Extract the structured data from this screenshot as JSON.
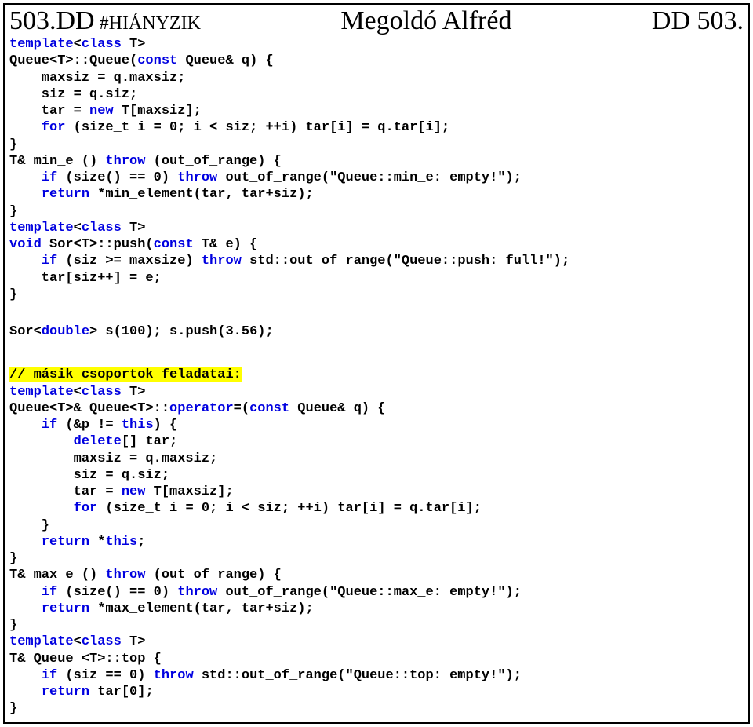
{
  "header": {
    "left_num": "503.DD",
    "left_tag": " #HIÁNYZIK",
    "center": "Megoldó Alfréd",
    "right": "DD 503."
  },
  "c": {
    "l01a": "template",
    "l01b": "<",
    "l01c": "class",
    "l01d": " T>",
    "l02a": "Queue<T>::Queue(",
    "l02b": "const",
    "l02c": " Queue& q) {",
    "l03": "    maxsiz = q.maxsiz;",
    "l04": "    siz = q.siz;",
    "l05a": "    tar = ",
    "l05b": "new",
    "l05c": " T[maxsiz];",
    "l06a": "    ",
    "l06b": "for",
    "l06c": " (size_t i = 0; i < siz; ++i) tar[i] = q.tar[i];",
    "l07": "}",
    "l08a": "T& min_e () ",
    "l08b": "throw",
    "l08c": " (out_of_range) {",
    "l09a": "    ",
    "l09b": "if",
    "l09c": " (size() == 0) ",
    "l09d": "throw",
    "l09e": " out_of_range(\"Queue::min_e: empty!\");",
    "l10a": "    ",
    "l10b": "return",
    "l10c": " *min_element(tar, tar+siz);",
    "l11": "}",
    "l12a": "template",
    "l12b": "<",
    "l12c": "class",
    "l12d": " T>",
    "l13a": "void",
    "l13b": " Sor<T>::push(",
    "l13c": "const",
    "l13d": " T& e) {",
    "l14a": "    ",
    "l14b": "if",
    "l14c": " (siz >= maxsize) ",
    "l14d": "throw",
    "l14e": " std::out_of_range(\"Queue::push: full!\");",
    "l15": "    tar[siz++] = e;",
    "l16": "}",
    "l17a": "Sor<",
    "l17b": "double",
    "l17c": "> s(100); s.push(3.56);",
    "l18": "// másik csoportok feladatai:",
    "l19a": "template",
    "l19b": "<",
    "l19c": "class",
    "l19d": " T>",
    "l20a": "Queue<T>& Queue<T>::",
    "l20b": "operator",
    "l20c": "=(",
    "l20d": "const",
    "l20e": " Queue& q) {",
    "l21a": "    ",
    "l21b": "if",
    "l21c": " (&p != ",
    "l21d": "this",
    "l21e": ") {",
    "l22a": "        ",
    "l22b": "delete",
    "l22c": "[] tar;",
    "l23": "        maxsiz = q.maxsiz;",
    "l24": "        siz = q.siz;",
    "l25a": "        tar = ",
    "l25b": "new",
    "l25c": " T[maxsiz];",
    "l26a": "        ",
    "l26b": "for",
    "l26c": " (size_t i = 0; i < siz; ++i) tar[i] = q.tar[i];",
    "l27": "    }",
    "l28a": "    ",
    "l28b": "return",
    "l28c": " *",
    "l28d": "this",
    "l28e": ";",
    "l29": "}",
    "l30a": "T& max_e () ",
    "l30b": "throw",
    "l30c": " (out_of_range) {",
    "l31a": "    ",
    "l31b": "if",
    "l31c": " (size() == 0) ",
    "l31d": "throw",
    "l31e": " out_of_range(\"Queue::max_e: empty!\");",
    "l32a": "    ",
    "l32b": "return",
    "l32c": " *max_element(tar, tar+siz);",
    "l33": "}",
    "l34a": "template",
    "l34b": "<",
    "l34c": "class",
    "l34d": " T>",
    "l35": "T& Queue <T>::top {",
    "l36a": "    ",
    "l36b": "if",
    "l36c": " (siz == 0) ",
    "l36d": "throw",
    "l36e": " std::out_of_range(\"Queue::top: empty!\");",
    "l37a": "    ",
    "l37b": "return",
    "l37c": " tar[0];",
    "l38": "}"
  }
}
